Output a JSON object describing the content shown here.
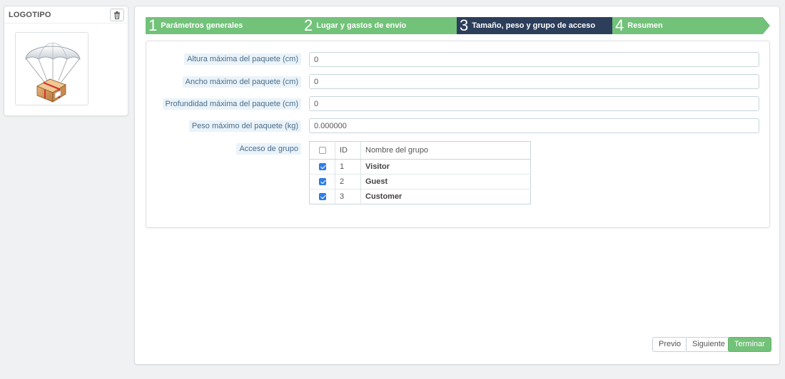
{
  "logo_panel": {
    "title": "LOGOTIPO",
    "delete_icon": "trash-icon",
    "image_icon": "parachute-package-icon"
  },
  "steps": [
    {
      "number": "1",
      "label": "Parámetros generales",
      "state": "done"
    },
    {
      "number": "2",
      "label": "Lugar y gastos de envío",
      "state": "done"
    },
    {
      "number": "3",
      "label": "Tamaño, peso y grupo de acceso",
      "state": "current"
    },
    {
      "number": "4",
      "label": "Resumen",
      "state": "done"
    }
  ],
  "form": {
    "height": {
      "label": "Altura máxima del paquete (cm)",
      "value": "0"
    },
    "width": {
      "label": "Ancho máximo del paquete (cm)",
      "value": "0"
    },
    "depth": {
      "label": "Profundidad máxima del paquete (cm)",
      "value": "0"
    },
    "weight": {
      "label": "Peso máximo del paquete (kg)",
      "value": "0.000000"
    },
    "group_access": {
      "label": "Acceso de grupo",
      "columns": {
        "id": "ID",
        "name": "Nombre del grupo"
      },
      "select_all_checked": false,
      "rows": [
        {
          "id": "1",
          "name": "Visitor",
          "checked": true
        },
        {
          "id": "2",
          "name": "Guest",
          "checked": true
        },
        {
          "id": "3",
          "name": "Customer",
          "checked": true
        }
      ]
    }
  },
  "footer": {
    "prev_label": "Previo",
    "next_label": "Siguiente",
    "finish_label": "Terminar"
  },
  "colors": {
    "step_done": "#72c279",
    "step_current": "#2c3e5a",
    "primary_button": "#72c279",
    "checkbox_checked": "#2f80ed"
  }
}
